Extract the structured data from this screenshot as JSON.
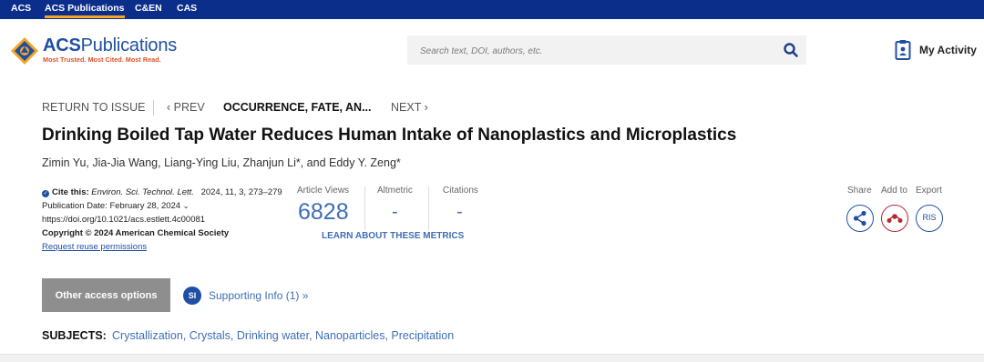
{
  "topbar": {
    "links": [
      "ACS",
      "ACS Publications",
      "C&EN",
      "CAS"
    ],
    "active_index": 1,
    "bg_color": "#0c2e8b",
    "active_underline_color": "#f5a524"
  },
  "logo": {
    "brand": "ACS",
    "brand_suffix": "Publications",
    "tagline": "Most Trusted. Most Cited. Most Read."
  },
  "search": {
    "placeholder": "Search text, DOI, authors, etc.",
    "value": "",
    "icon": "search-icon"
  },
  "activity": {
    "label": "My Activity",
    "icon": "my-activity-icon"
  },
  "nav": {
    "return": "RETURN TO ISSUE",
    "prev": "‹ PREV",
    "current": "OCCURRENCE, FATE, AN...",
    "next": "NEXT ›"
  },
  "article": {
    "title": "Drinking Boiled Tap Water Reduces Human Intake of Nanoplastics and Microplastics",
    "authors": "Zimin Yu, Jia-Jia Wang, Liang-Ying Liu, Zhanjun Li*, and Eddy Y. Zeng*"
  },
  "cite": {
    "label": "Cite this:",
    "journal": "Environ. Sci. Technol. Lett.",
    "ref": "2024, 11, 3, 273–279",
    "pub_date": "Publication Date: February 28, 2024",
    "doi": "https://doi.org/10.1021/acs.estlett.4c00081",
    "copyright": "Copyright © 2024 American Chemical Society",
    "reuse": "Request reuse permissions"
  },
  "metrics": {
    "views_label": "Article Views",
    "views_value": "6828",
    "altmetric_label": "Altmetric",
    "altmetric_value": "-",
    "citations_label": "Citations",
    "citations_value": "-",
    "learn_more": "LEARN ABOUT THESE METRICS"
  },
  "tools": {
    "share_label": "Share",
    "add_label": "Add to",
    "export_label": "Export",
    "export_btn": "RIS",
    "share_color": "#1f4fa2",
    "add_color": "#b8292f"
  },
  "access": {
    "button": "Other access options"
  },
  "supporting": {
    "badge": "SI",
    "link": "Supporting Info (1) »"
  },
  "subjects": {
    "label": "SUBJECTS:",
    "items": [
      "Crystallization",
      "Crystals",
      "Drinking water",
      "Nanoparticles",
      "Precipitation"
    ]
  }
}
